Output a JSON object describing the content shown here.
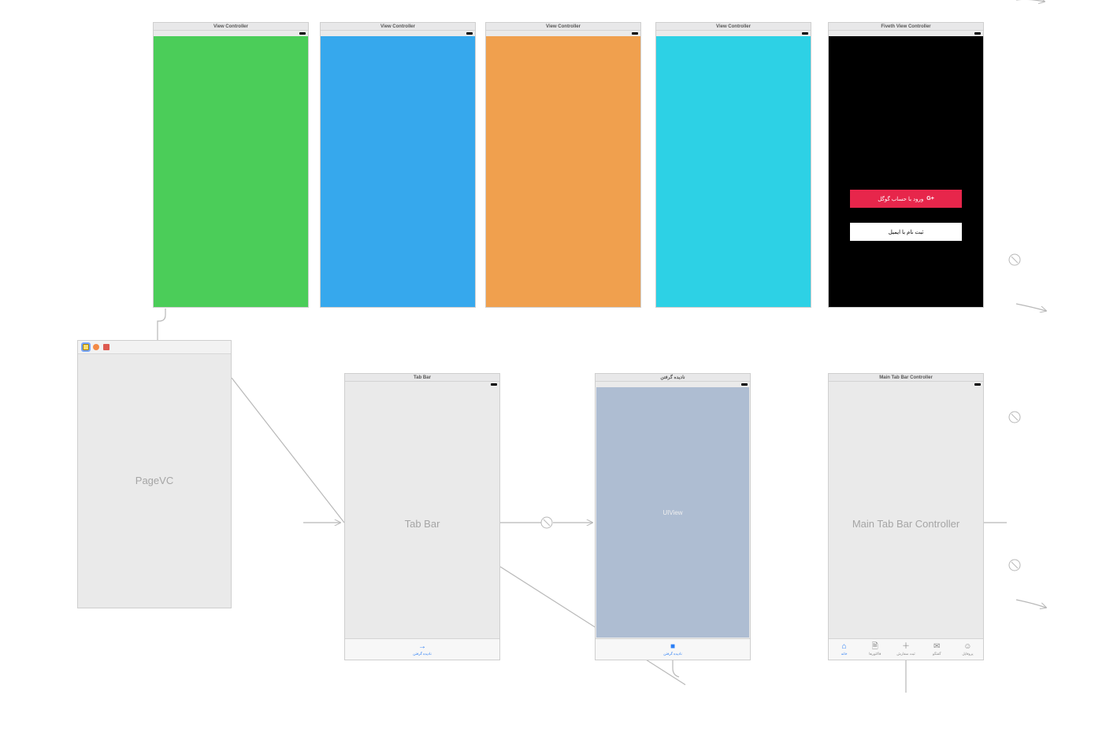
{
  "top_row": [
    {
      "title": "View Controller",
      "color": "#4bcd59"
    },
    {
      "title": "View Controller",
      "color": "#36a8ed"
    },
    {
      "title": "View Controller",
      "color": "#f0a04e"
    },
    {
      "title": "View Controller",
      "color": "#2dd1e5"
    }
  ],
  "fiveth": {
    "title": "Fiveth View Controller",
    "bg": "#000000",
    "google_btn": "ورود با حساب گوگل",
    "google_badge": "G+",
    "email_btn": "ثبت نام با ایمیل"
  },
  "pagevc": {
    "label": "PageVC"
  },
  "tabbar_scene": {
    "title": "Tab Bar",
    "label": "Tab Bar",
    "tab_label": "نادیده گرفتن",
    "tab_icon": "→"
  },
  "uiview_scene": {
    "title": "نادیده گرفتن",
    "inner": "UIView",
    "tab_label": "نادیده گرفتن",
    "tab_icon": "■"
  },
  "main_tab": {
    "title": "Main Tab Bar Controller",
    "label": "Main Tab Bar Controller",
    "tabs": [
      {
        "icon": "⌂",
        "label": "خانه"
      },
      {
        "icon": "🗎",
        "label": "فاکتورها"
      },
      {
        "icon": "＋",
        "label": "ثبت سفارش"
      },
      {
        "icon": "✉",
        "label": "گفتگو"
      },
      {
        "icon": "☺",
        "label": "پروفایل"
      }
    ]
  }
}
